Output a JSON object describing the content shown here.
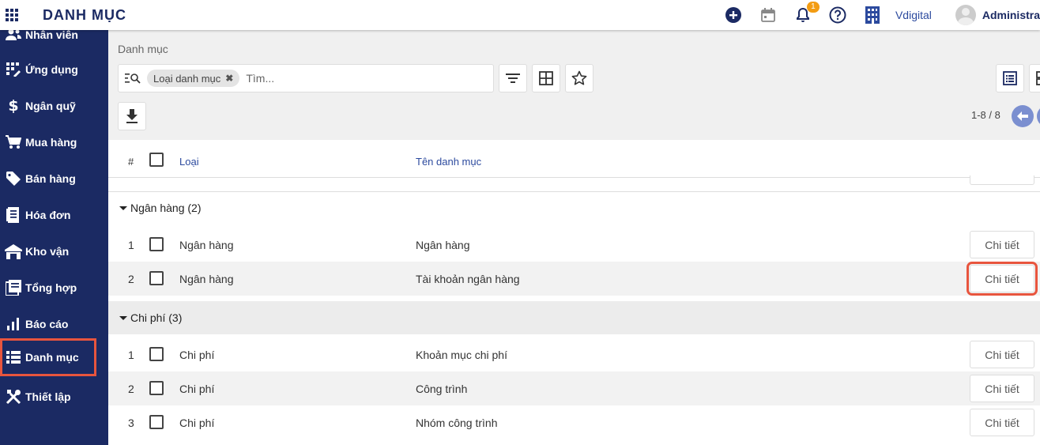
{
  "header": {
    "module_title": "DANH MỤC",
    "notification_count": "1",
    "company": "Vdigital",
    "user": "Administra"
  },
  "sidebar": {
    "items": [
      {
        "label": "Nhân viên",
        "icon": "people-icon"
      },
      {
        "label": "Ứng dụng",
        "icon": "apps-icon"
      },
      {
        "label": "Ngân quỹ",
        "icon": "dollar-icon"
      },
      {
        "label": "Mua hàng",
        "icon": "cart-icon"
      },
      {
        "label": "Bán hàng",
        "icon": "tag-icon"
      },
      {
        "label": "Hóa đơn",
        "icon": "receipt-icon"
      },
      {
        "label": "Kho vận",
        "icon": "warehouse-icon"
      },
      {
        "label": "Tổng hợp",
        "icon": "summary-icon"
      },
      {
        "label": "Báo cáo",
        "icon": "bar-chart-icon"
      },
      {
        "label": "Danh mục",
        "icon": "list-icon"
      },
      {
        "label": "Thiết lập",
        "icon": "tools-icon"
      }
    ],
    "active": "Danh mục"
  },
  "breadcrumb": "Danh mục",
  "search": {
    "filter_chip": "Loại danh mục",
    "placeholder": "Tìm..."
  },
  "pager": "1-8 / 8",
  "table": {
    "columns": {
      "index": "#",
      "type": "Loại",
      "name": "Tên danh mục"
    },
    "groups": [
      {
        "label": "Ngân hàng (2)",
        "rows": [
          {
            "index": "1",
            "type": "Ngân hàng",
            "name": "Ngân hàng",
            "action": "Chi tiết"
          },
          {
            "index": "2",
            "type": "Ngân hàng",
            "name": "Tài khoản ngân hàng",
            "action": "Chi tiết"
          }
        ]
      },
      {
        "label": "Chi phí (3)",
        "rows": [
          {
            "index": "1",
            "type": "Chi phí",
            "name": "Khoản mục chi phí",
            "action": "Chi tiết"
          },
          {
            "index": "2",
            "type": "Chi phí",
            "name": "Công trình",
            "action": "Chi tiết"
          },
          {
            "index": "3",
            "type": "Chi phí",
            "name": "Nhóm công trình",
            "action": "Chi tiết"
          }
        ]
      }
    ]
  },
  "colors": {
    "sidebar_bg": "#1b2a63",
    "accent": "#2c4a9e",
    "highlight": "#e8553e",
    "badge": "#f39c12"
  }
}
